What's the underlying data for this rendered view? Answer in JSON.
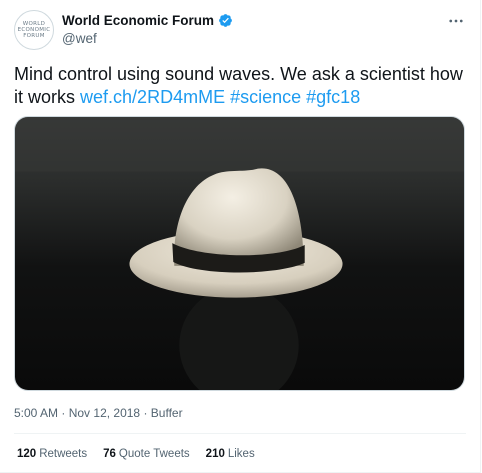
{
  "author": {
    "name": "World Economic Forum",
    "handle": "@wef",
    "avatar_lines": [
      "WORLD",
      "ECONOMIC",
      "FORUM"
    ],
    "verified": true
  },
  "tweet": {
    "text": "Mind control using sound waves. We ask a scientist how it works",
    "link": "wef.ch/2RD4mME",
    "hashtags": [
      "#science",
      "#gfc18"
    ],
    "image_icon": "hat-photo"
  },
  "meta": {
    "time": "5:00 AM",
    "date": "Nov 12, 2018",
    "source": "Buffer",
    "separator": "·"
  },
  "stats": [
    {
      "count": "120",
      "label": "Retweets"
    },
    {
      "count": "76",
      "label": "Quote Tweets"
    },
    {
      "count": "210",
      "label": "Likes"
    }
  ],
  "colors": {
    "accent": "#1d9bf0",
    "text": "#0f1419",
    "secondary": "#536471"
  }
}
